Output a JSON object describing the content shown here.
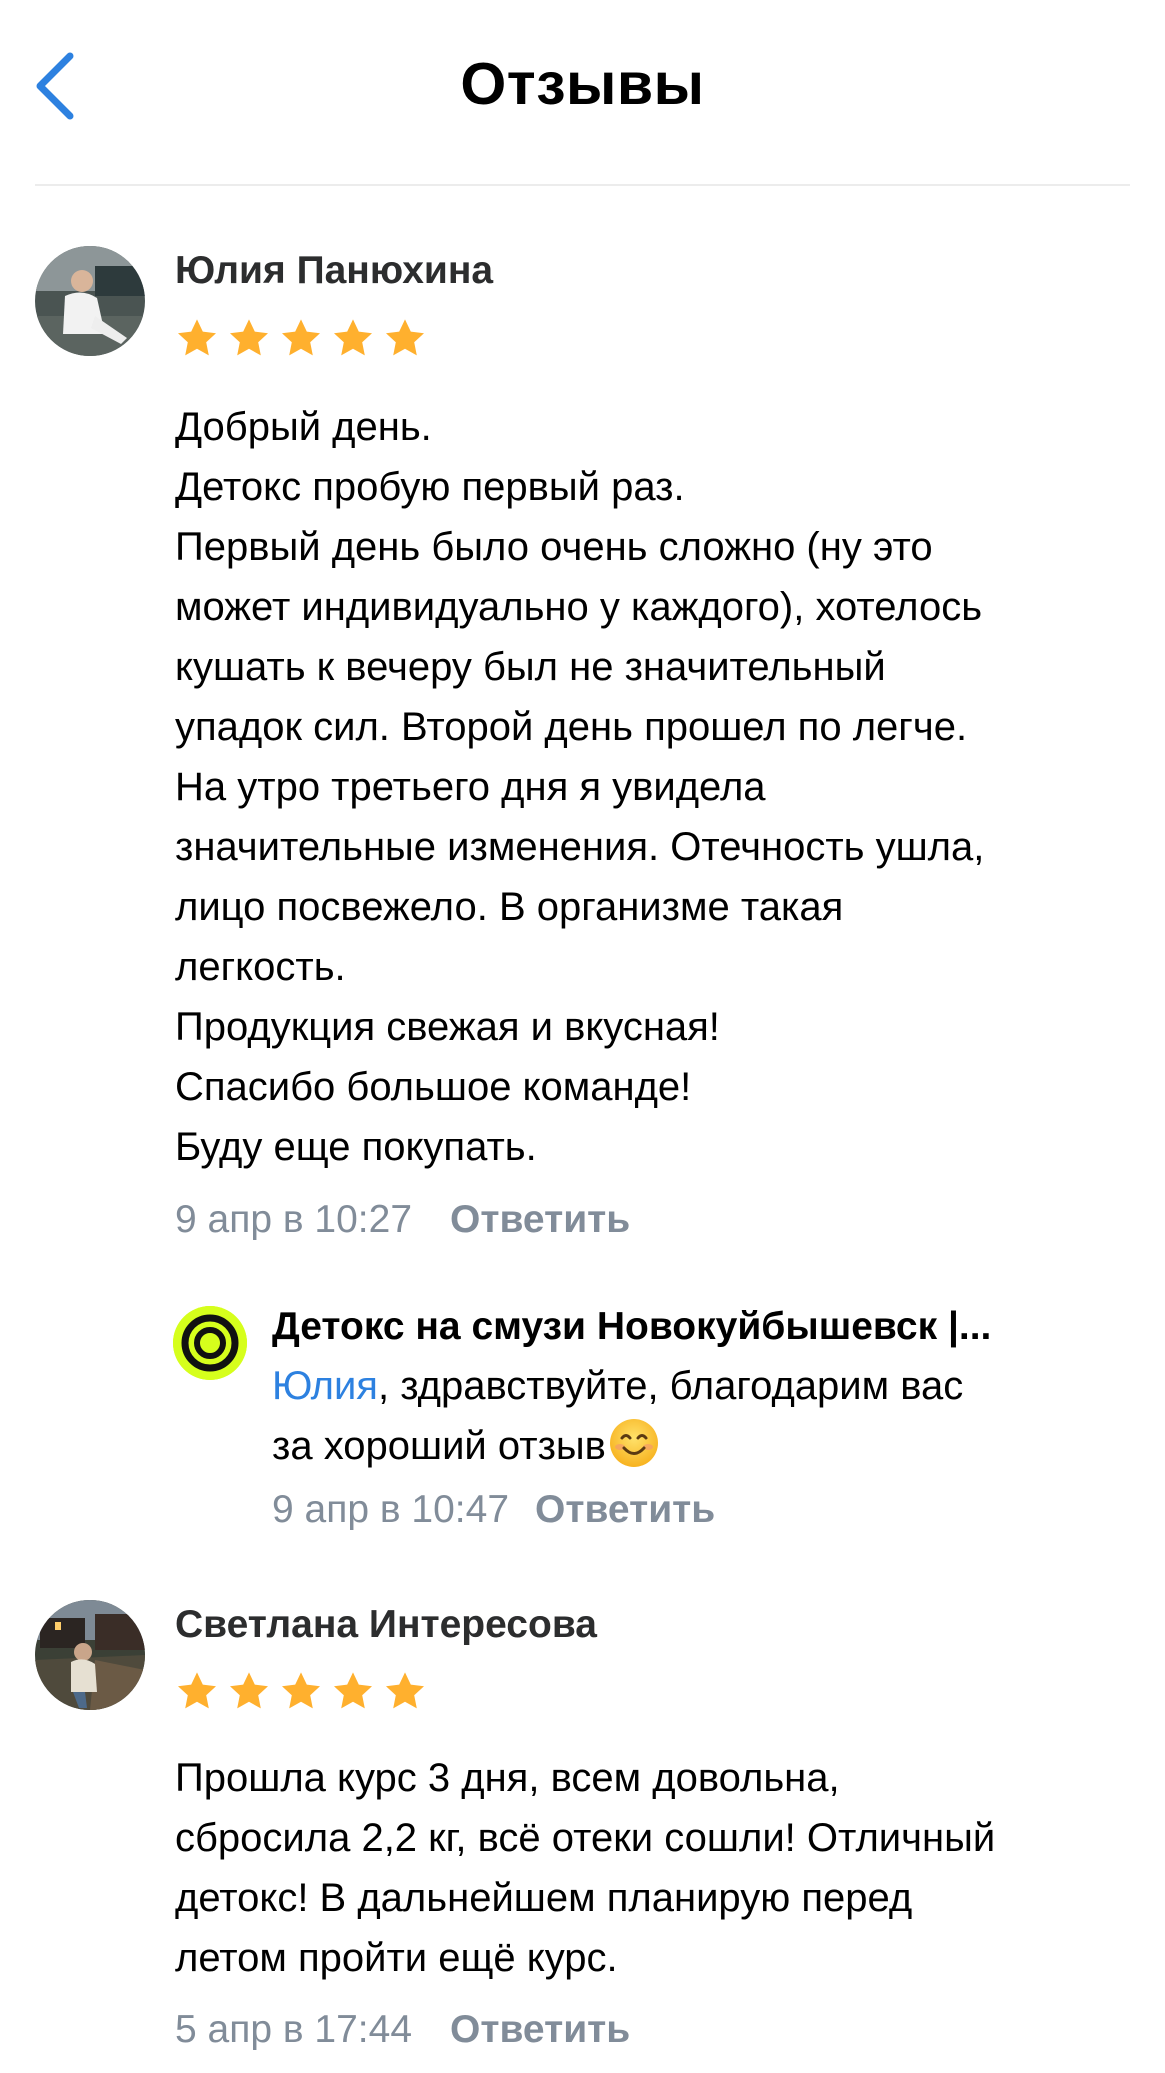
{
  "header": {
    "title": "Отзывы",
    "back_icon": "chevron-left-icon",
    "accent": "#2d81e0"
  },
  "reviews": [
    {
      "author": "Юлия Панюхина",
      "rating": 5,
      "text_lines": [
        "Добрый день.",
        "Детокс пробую первый раз.",
        "Первый день было очень сложно (ну это",
        "может индивидуально у каждого), хотелось",
        "кушать к вечеру был не значительный",
        "упадок сил. Второй день прошел по легче.",
        "На утро третьего дня я увидела",
        "значительные изменения. Отечность ушла,",
        "лицо посвежело. В организме такая",
        "легкость.",
        "Продукция свежая и вкусная!",
        "Спасибо большое команде!",
        "Буду еще покупать."
      ],
      "date": "9 апр в 10:27",
      "reply_label": "Ответить",
      "reply": {
        "author": "Детокс на смузи Новокуйбышевск |...",
        "mention": "Юлия",
        "text_line1": ", здравствуйте, благодарим вас",
        "text_line2": "за хороший отзыв",
        "emoji": "smiling-face-emoji",
        "date": "9 апр в 10:47",
        "reply_label": "Ответить"
      }
    },
    {
      "author": "Светлана Интересова",
      "rating": 5,
      "text_lines": [
        "Прошла курс 3 дня, всем довольна,",
        "сбросила 2,2 кг, всё отеки сошли! Отличный",
        "детокс! В дальнейшем планирую перед",
        "летом пройти ещё курс."
      ],
      "date": "5 апр в 17:44",
      "reply_label": "Ответить"
    }
  ],
  "colors": {
    "star": "#ffb02e",
    "meta_gray": "#818c99",
    "link_blue": "#2d81e0",
    "brand_lime": "#d6ff1c"
  }
}
